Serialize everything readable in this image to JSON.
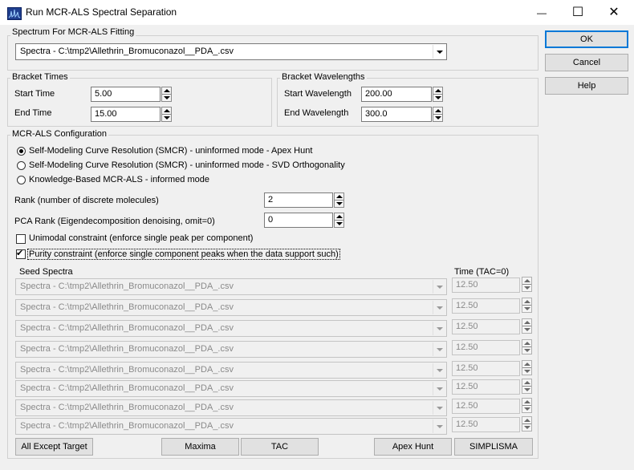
{
  "window": {
    "title": "Run MCR-ALS Spectral Separation",
    "minimize_glyph": "—",
    "maximize_glyph": "☐",
    "close_glyph": "✕"
  },
  "spectrum_group": {
    "legend": "Spectrum For MCR-ALS Fitting",
    "selected": "Spectra - C:\\tmp2\\Allethrin_Bromuconazol__PDA_.csv"
  },
  "bracket_times": {
    "legend": "Bracket Times",
    "start_label": "Start Time",
    "start_value": "5.00",
    "end_label": "End Time",
    "end_value": "15.00"
  },
  "bracket_wavelengths": {
    "legend": "Bracket Wavelengths",
    "start_label": "Start Wavelength",
    "start_value": "200.00",
    "end_label": "End Wavelength",
    "end_value": "300.0"
  },
  "config": {
    "legend": "MCR-ALS Configuration",
    "modes": [
      {
        "label": "Self-Modeling Curve Resolution (SMCR) - uninformed mode - Apex Hunt",
        "selected": true
      },
      {
        "label": "Self-Modeling Curve Resolution (SMCR) - uninformed mode - SVD Orthogonality",
        "selected": false
      },
      {
        "label": "Knowledge-Based MCR-ALS - informed mode",
        "selected": false
      }
    ],
    "rank_label": "Rank (number of discrete molecules)",
    "rank_value": "2",
    "pca_label": "PCA Rank (Eigendecomposition denoising, omit=0)",
    "pca_value": "0",
    "unimodal_label": "Unimodal constraint (enforce single peak per component)",
    "unimodal_checked": false,
    "purity_label": "Purity constraint (enforce single component peaks when the data support such)",
    "purity_checked": true,
    "checkmark": "✔",
    "seed_header": "Seed Spectra",
    "time_header": "Time (TAC=0)",
    "seed_rows": [
      {
        "spectrum": "Spectra - C:\\tmp2\\Allethrin_Bromuconazol__PDA_.csv",
        "time": "12.50"
      },
      {
        "spectrum": "Spectra - C:\\tmp2\\Allethrin_Bromuconazol__PDA_.csv",
        "time": "12.50"
      },
      {
        "spectrum": "Spectra - C:\\tmp2\\Allethrin_Bromuconazol__PDA_.csv",
        "time": "12.50"
      },
      {
        "spectrum": "Spectra - C:\\tmp2\\Allethrin_Bromuconazol__PDA_.csv",
        "time": "12.50"
      },
      {
        "spectrum": "Spectra - C:\\tmp2\\Allethrin_Bromuconazol__PDA_.csv",
        "time": "12.50"
      },
      {
        "spectrum": "Spectra - C:\\tmp2\\Allethrin_Bromuconazol__PDA_.csv",
        "time": "12.50"
      },
      {
        "spectrum": "Spectra - C:\\tmp2\\Allethrin_Bromuconazol__PDA_.csv",
        "time": "12.50"
      },
      {
        "spectrum": "Spectra - C:\\tmp2\\Allethrin_Bromuconazol__PDA_.csv",
        "time": "12.50"
      }
    ]
  },
  "bottom_buttons": {
    "all_except_target": "All Except Target",
    "maxima": "Maxima",
    "tac": "TAC",
    "apex_hunt": "Apex Hunt",
    "simplisma": "SIMPLISMA"
  },
  "side_buttons": {
    "ok": "OK",
    "cancel": "Cancel",
    "help": "Help"
  }
}
